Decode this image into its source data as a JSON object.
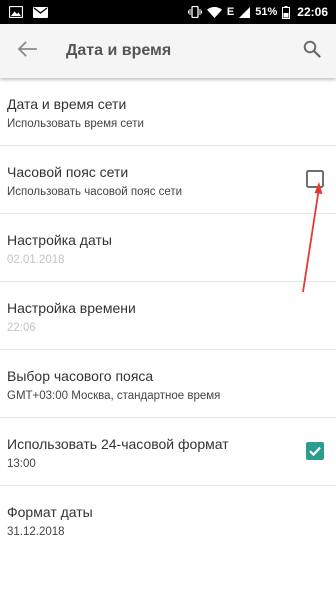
{
  "status_bar": {
    "battery": "51%",
    "time": "22:06",
    "network": "E",
    "icons": [
      "image-icon",
      "mail-icon",
      "vibrate-icon",
      "wifi-icon",
      "signal-icon",
      "battery-icon"
    ]
  },
  "app_bar": {
    "title": "Дата и время",
    "back_icon": "arrow-left-icon",
    "search_icon": "search-icon"
  },
  "settings": [
    {
      "title": "Дата и время сети",
      "subtitle": "Использовать время сети",
      "disabled": false
    },
    {
      "title": "Часовой пояс сети",
      "subtitle": "Использовать часовой пояс сети",
      "checkbox": false
    },
    {
      "title": "Настройка даты",
      "subtitle": "02.01.2018",
      "disabled": true
    },
    {
      "title": "Настройка времени",
      "subtitle": "22:06",
      "disabled": true
    },
    {
      "title": "Выбор часового пояса",
      "subtitle": "GMT+03:00 Москва, стандартное время",
      "disabled": false
    },
    {
      "title": "Использовать 24-часовой формат",
      "subtitle": "13:00",
      "checkbox": true
    },
    {
      "title": "Формат даты",
      "subtitle": "31.12.2018",
      "disabled": false
    }
  ],
  "colors": {
    "accent": "#2a9d8f",
    "annotation_arrow": "#e53935",
    "status_bar": "#000000",
    "app_bar": "#f5f5f5"
  }
}
